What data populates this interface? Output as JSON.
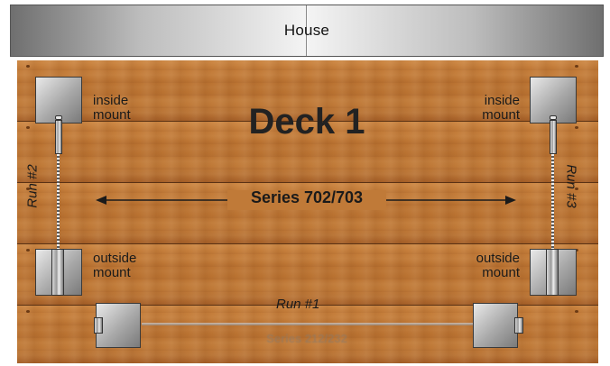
{
  "house": {
    "label": "House"
  },
  "deck": {
    "title": "Deck 1"
  },
  "mounts": {
    "inside_left": "inside\nmount",
    "inside_right": "inside\nmount",
    "outside_left": "outside\nmount",
    "outside_right": "outside\nmount"
  },
  "runs": {
    "run1": "Run #1",
    "run2": "Run #2",
    "run3": "Run #3"
  },
  "series": {
    "main": "Series 702/703",
    "secondary": "Series 212/232"
  },
  "colors": {
    "wood": "#b8702f",
    "wood_seam": "#5a3214",
    "metal": "#a8a8a8",
    "text": "#1a1a1a"
  }
}
